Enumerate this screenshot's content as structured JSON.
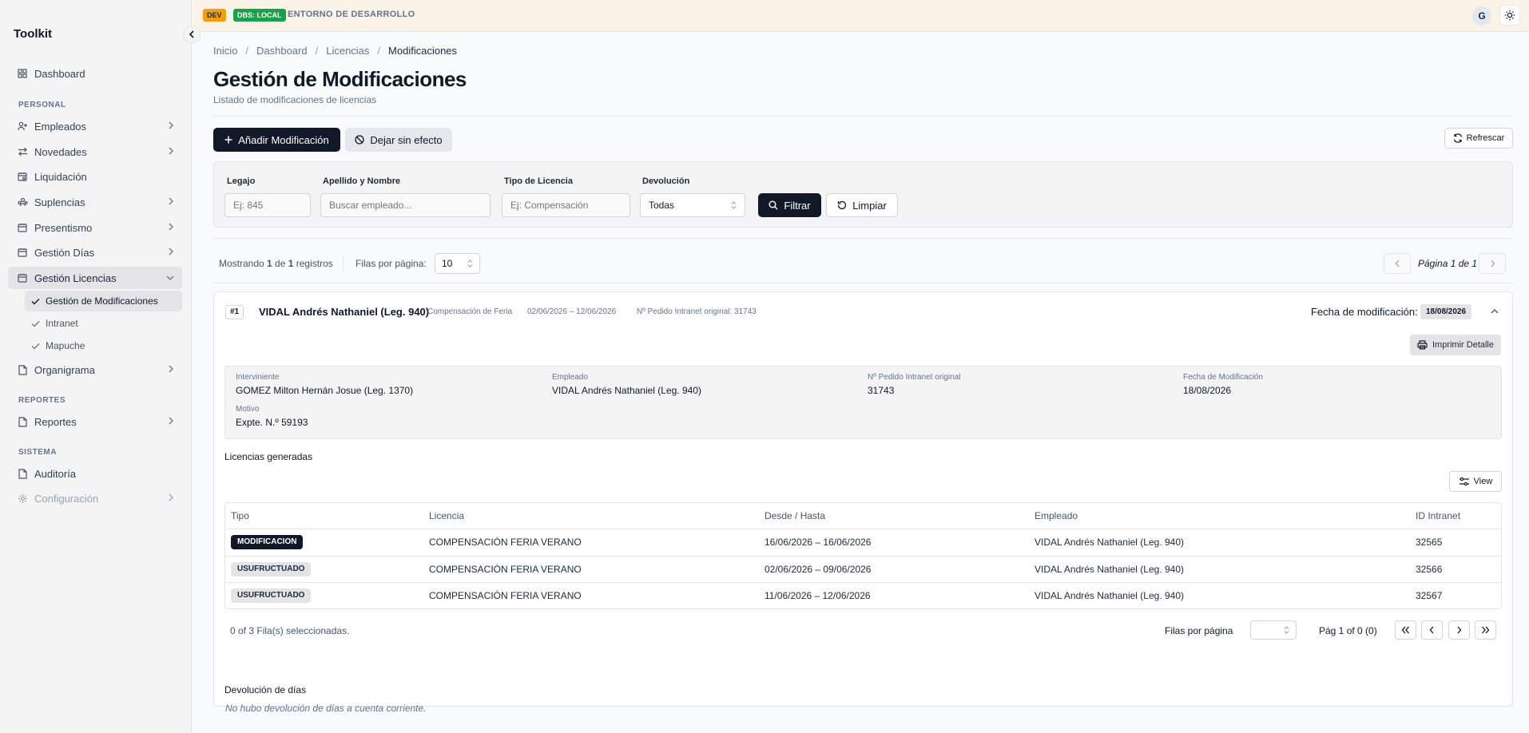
{
  "app": {
    "brand": "Toolkit"
  },
  "topbar": {
    "dev_badge": "DEV",
    "dbs_badge": "DBS: LOCAL",
    "environment": "ENTORNO DE DESARROLLO",
    "avatar_initial": "G"
  },
  "sidebar": {
    "dashboard": "Dashboard",
    "section_personal": "PERSONAL",
    "empleados": "Empleados",
    "novedades": "Novedades",
    "liquidacion": "Liquidación",
    "suplencias": "Suplencias",
    "presentismo": "Presentismo",
    "gestion_dias": "Gestión Días",
    "gestion_licencias": "Gestión Licencias",
    "sub_gestion_modificaciones": "Gestión de Modificaciones",
    "sub_intranet": "Intranet",
    "sub_mapuche": "Mapuche",
    "organigrama": "Organigrama",
    "section_reportes": "REPORTES",
    "reportes": "Reportes",
    "section_sistema": "SISTEMA",
    "auditoria": "Auditoría",
    "configuracion": "Configuración"
  },
  "breadcrumb": {
    "inicio": "Inicio",
    "dashboard": "Dashboard",
    "licencias": "Licencias",
    "current": "Modificaciones"
  },
  "page": {
    "title": "Gestión de Modificaciones",
    "subtitle": "Listado de modificaciones de licencias"
  },
  "actions": {
    "add": "Añadir Modificación",
    "void": "Dejar sin efecto",
    "refresh": "Refrescar"
  },
  "filters": {
    "legajo_label": "Legajo",
    "legajo_placeholder": "Ej: 845",
    "nombre_label": "Apellido y Nombre",
    "nombre_placeholder": "Buscar empleado...",
    "tipo_label": "Tipo de Licencia",
    "tipo_placeholder": "Ej: Compensación",
    "devolucion_label": "Devolución",
    "devolucion_value": "Todas",
    "filter_btn": "Filtrar",
    "clear_btn": "Limpiar"
  },
  "results": {
    "showing_prefix": "Mostrando ",
    "showing_count": "1",
    "showing_mid": " de ",
    "showing_total": "1",
    "showing_suffix": " registros",
    "rows_per_page_label": "Filas por página:",
    "rows_per_page": "10",
    "page_indicator": "Página 1 de 1"
  },
  "record": {
    "number": "#1",
    "name": "VIDAL Andrés Nathaniel (Leg. 940)",
    "type": "Compensación de Feria",
    "range": "02/06/2026 – 12/06/2026",
    "intranet_ref": "Nº Pedido Intranet original: 31743",
    "mod_date_label": "Fecha de modificación:",
    "mod_date": "18/08/2026",
    "print_btn": "Imprimir Detalle",
    "details": {
      "interviniente_label": "Interviniente",
      "interviniente": "GOMEZ Milton Hernán Josue (Leg. 1370)",
      "empleado_label": "Empleado",
      "empleado": "VIDAL Andrés Nathaniel (Leg. 940)",
      "pedido_label": "Nº Pedido Intranet original",
      "pedido": "31743",
      "fecha_label": "Fecha de Modificación",
      "fecha": "18/08/2026",
      "motivo_label": "Motivo",
      "motivo": "Expte. N.º 59193"
    },
    "licencias_title": "Licencias generadas",
    "view_btn": "View",
    "table": {
      "headers": [
        "Tipo",
        "Licencia",
        "Desde / Hasta",
        "Empleado",
        "ID Intranet"
      ],
      "rows": [
        {
          "tipo": "MODIFICACION",
          "licencia": "COMPENSACIÓN FERIA VERANO",
          "rango": "16/06/2026 – 16/06/2026",
          "empleado": "VIDAL Andrés Nathaniel (Leg. 940)",
          "id": "32565"
        },
        {
          "tipo": "USUFRUCTUADO",
          "licencia": "COMPENSACIÓN FERIA VERANO",
          "rango": "02/06/2026 – 09/06/2026",
          "empleado": "VIDAL Andrés Nathaniel (Leg. 940)",
          "id": "32566"
        },
        {
          "tipo": "USUFRUCTUADO",
          "licencia": "COMPENSACIÓN FERIA VERANO",
          "rango": "11/06/2026 – 12/06/2026",
          "empleado": "VIDAL Andrés Nathaniel (Leg. 940)",
          "id": "32567"
        }
      ]
    },
    "selection_text": "0 of 3 Fila(s) seleccionadas.",
    "rows_per_page_label": "Filas por página",
    "page_text": "Pág 1 of 0 (0)",
    "devolucion_title": "Devolución de días",
    "devolucion_empty": "No hubo devolución de días a cuenta corriente."
  },
  "colors": {
    "accent_dark": "#111827",
    "dev_badge": "#f59e0b",
    "dbs_badge": "#16a34a",
    "topbar_bg": "#fbf3e8"
  }
}
